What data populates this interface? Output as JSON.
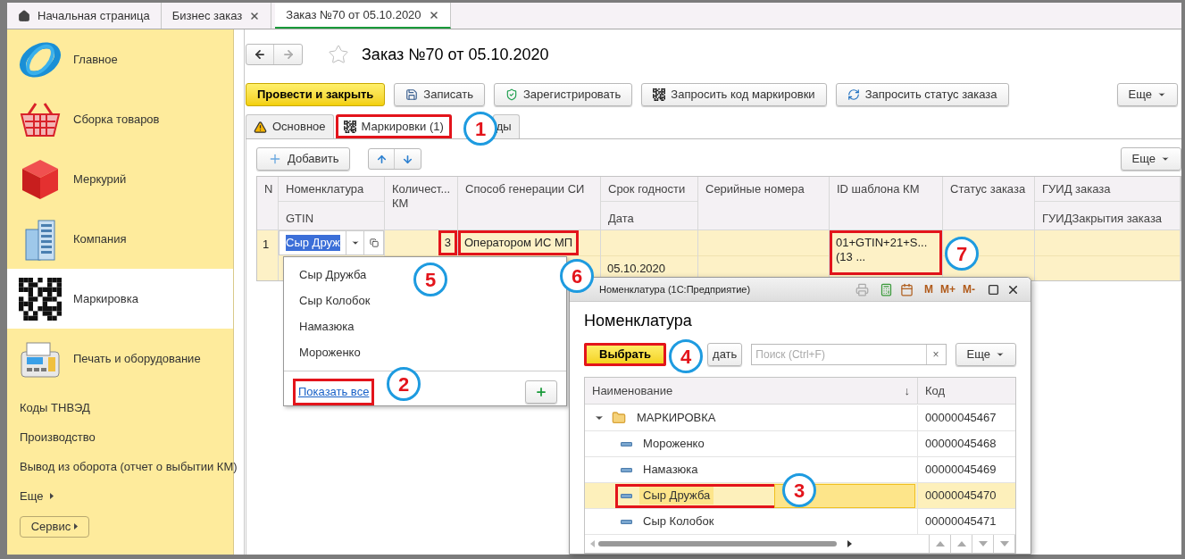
{
  "top_tabs": [
    {
      "label": "Начальная страница",
      "kind": "home",
      "selected": false
    },
    {
      "label": "Бизнес заказ",
      "kind": "doc",
      "selected": false
    },
    {
      "label": "Заказ №70 от 05.10.2020",
      "kind": "doc",
      "selected": true
    }
  ],
  "sidebar": {
    "items": [
      {
        "label": "Главное",
        "selected": false
      },
      {
        "label": "Сборка товаров",
        "selected": false
      },
      {
        "label": "Меркурий",
        "selected": false
      },
      {
        "label": "Компания",
        "selected": false
      },
      {
        "label": "Маркировка",
        "selected": true
      },
      {
        "label": "Печать и оборудование",
        "selected": false
      }
    ],
    "links": [
      "Коды ТНВЭД",
      "Производство",
      "Вывод из оборота (отчет о выбытии КМ)"
    ],
    "more": "Еще",
    "service_button": "Сервис"
  },
  "document": {
    "title": "Заказ №70 от 05.10.2020",
    "toolbar": [
      {
        "label": "Провести и закрыть",
        "kind": "primary"
      },
      {
        "label": "Записать",
        "kind": "save"
      },
      {
        "label": "Зарегистрировать",
        "kind": "shield"
      },
      {
        "label": "Запросить код маркировки",
        "kind": "qr"
      },
      {
        "label": "Запросить статус заказа",
        "kind": "refresh"
      }
    ],
    "more": "Еще",
    "tabs": [
      {
        "label": "Основное",
        "selected": false,
        "highlight": false
      },
      {
        "label": "Маркировки (1)",
        "selected": true,
        "highlight": true
      },
      {
        "label": "ды",
        "selected": false,
        "highlight": false
      }
    ],
    "table_toolbar": {
      "add": "Добавить",
      "more": "Еще"
    },
    "table": {
      "columns": [
        {
          "header": "N"
        },
        {
          "header": "Номенклатура",
          "subheader": "GTIN"
        },
        {
          "header": "Количест...\nКМ"
        },
        {
          "header": "Способ генерации СИ"
        },
        {
          "header": "Срок годности",
          "subheader": "Дата"
        },
        {
          "header": "Серийные номера"
        },
        {
          "header": "ID шаблона КМ"
        },
        {
          "header": "Статус заказа"
        },
        {
          "header": "ГУИД заказа",
          "subheader": "ГУИДЗакрытия заказа"
        }
      ],
      "rows": [
        {
          "selected": true,
          "cells": [
            {
              "value": "1"
            },
            {
              "value": "Сыр Друж"
            },
            {
              "value": "3",
              "highlight": true
            },
            {
              "value": "Оператором ИС МП",
              "highlight": true
            },
            {
              "sub": "05.10.2020"
            },
            {},
            {
              "value": "01+GTIN+21+S...\n (13 ...",
              "highlight": true
            },
            {},
            {}
          ]
        }
      ]
    }
  },
  "dropdown": {
    "items": [
      "Сыр Дружба",
      "Сыр Колобок",
      "Намазюка",
      "Мороженко"
    ],
    "show_all": "Показать все",
    "show_all_highlight": true
  },
  "picker": {
    "window_title": "Номенклатура (1С:Предприятие)",
    "memory_buttons": [
      "M",
      "M+",
      "M-"
    ],
    "heading": "Номенклатура",
    "choose": "Выбрать",
    "choose_highlight": true,
    "create": "дать",
    "search": {
      "placeholder": "Поиск (Ctrl+F)",
      "clear": "×"
    },
    "more": "Еще",
    "columns": [
      {
        "label": "Наименование",
        "sort": "↓"
      },
      {
        "label": "Код"
      }
    ],
    "tree": [
      {
        "name": "МАРКИРОВКА",
        "code": "00000045467",
        "kind": "folder",
        "expanded": true,
        "selected": false,
        "highlight": false,
        "children": [
          {
            "name": "Мороженко",
            "code": "00000045468",
            "kind": "item",
            "selected": false,
            "highlight": false
          },
          {
            "name": "Намазюка",
            "code": "00000045469",
            "kind": "item",
            "selected": false,
            "highlight": false
          },
          {
            "name": "Сыр Дружба",
            "code": "00000045470",
            "kind": "item",
            "selected": true,
            "highlight": true
          },
          {
            "name": "Сыр Колобок",
            "code": "00000045471",
            "kind": "item",
            "selected": false,
            "highlight": false
          }
        ]
      }
    ]
  },
  "callouts": [
    "1",
    "2",
    "3",
    "4",
    "5",
    "6",
    "7"
  ]
}
